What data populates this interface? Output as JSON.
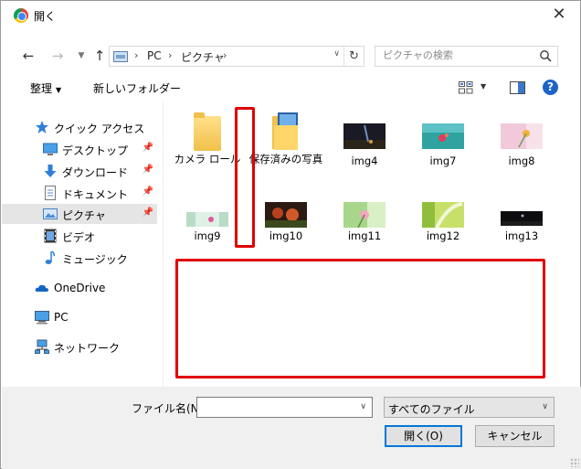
{
  "window": {
    "title": "開く"
  },
  "address": {
    "crumbs": [
      "PC",
      "ピクチャ"
    ]
  },
  "search": {
    "placeholder": "ピクチャの検索"
  },
  "toolbar": {
    "organize_label": "整理",
    "new_folder_label": "新しいフォルダー"
  },
  "sidebar": {
    "items": [
      {
        "label": "クイック アクセス",
        "icon": "star-icon"
      },
      {
        "label": "デスクトップ",
        "icon": "desktop-icon",
        "pinned": true
      },
      {
        "label": "ダウンロード",
        "icon": "download-arrow-icon",
        "pinned": true
      },
      {
        "label": "ドキュメント",
        "icon": "document-icon",
        "pinned": true
      },
      {
        "label": "ピクチャ",
        "icon": "pictures-icon",
        "pinned": true,
        "selected": true
      },
      {
        "label": "ビデオ",
        "icon": "video-icon"
      },
      {
        "label": "ミュージック",
        "icon": "music-note-icon"
      },
      {
        "label": "OneDrive",
        "icon": "cloud-icon"
      },
      {
        "label": "PC",
        "icon": "computer-icon"
      },
      {
        "label": "ネットワーク",
        "icon": "network-icon"
      }
    ]
  },
  "files": [
    {
      "name": "カメラ ロール",
      "kind": "folder"
    },
    {
      "name": "保存済みの写真",
      "kind": "folder-with-photos"
    },
    {
      "name": "img4",
      "kind": "image"
    },
    {
      "name": "img7",
      "kind": "image"
    },
    {
      "name": "img8",
      "kind": "image"
    },
    {
      "name": "img9",
      "kind": "image"
    },
    {
      "name": "img10",
      "kind": "image"
    },
    {
      "name": "img11",
      "kind": "image"
    },
    {
      "name": "img12",
      "kind": "image"
    },
    {
      "name": "img13",
      "kind": "image"
    }
  ],
  "bottom": {
    "filename_label": "ファイル名(N):",
    "filename_value": "",
    "filetype_value": "すべてのファイル",
    "open_label": "開く(O)",
    "cancel_label": "キャンセル"
  },
  "colors": {
    "accent": "#0078d7",
    "highlight": "#e00000",
    "selected_bg": "#e5e5e5"
  }
}
